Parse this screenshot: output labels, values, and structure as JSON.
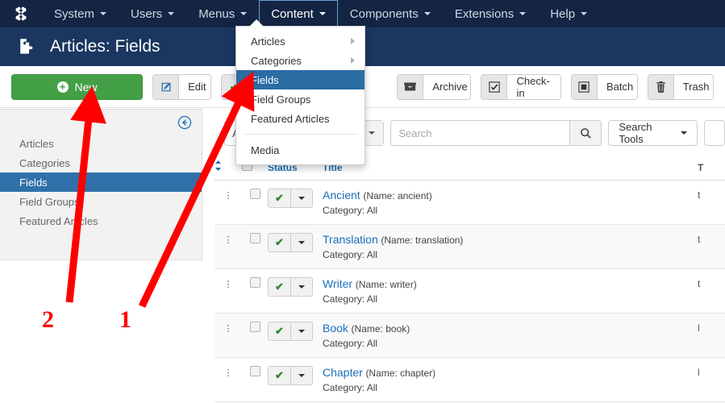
{
  "topbar": {
    "logo_icon": "joomla-logo-icon",
    "items": [
      {
        "label": "System",
        "has_caret": true,
        "active": false
      },
      {
        "label": "Users",
        "has_caret": true,
        "active": false
      },
      {
        "label": "Menus",
        "has_caret": true,
        "active": false
      },
      {
        "label": "Content",
        "has_caret": true,
        "active": true
      },
      {
        "label": "Components",
        "has_caret": true,
        "active": false
      },
      {
        "label": "Extensions",
        "has_caret": true,
        "active": false
      },
      {
        "label": "Help",
        "has_caret": true,
        "active": false
      }
    ]
  },
  "content_menu": {
    "items": [
      {
        "label": "Articles",
        "submenu": true,
        "active": false,
        "separator_after": false
      },
      {
        "label": "Categories",
        "submenu": true,
        "active": false,
        "separator_after": false
      },
      {
        "label": "Fields",
        "submenu": false,
        "active": true,
        "separator_after": false
      },
      {
        "label": "Field Groups",
        "submenu": false,
        "active": false,
        "separator_after": false
      },
      {
        "label": "Featured Articles",
        "submenu": false,
        "active": false,
        "separator_after": true
      },
      {
        "label": "Media",
        "submenu": false,
        "active": false,
        "separator_after": false
      }
    ]
  },
  "page_header": {
    "title": "Articles: Fields",
    "icon": "puzzle-piece-icon"
  },
  "toolbar": {
    "new_label": "New",
    "edit_label": "Edit",
    "publish_label": "",
    "archive_label": "Archive",
    "checkin_label": "Check-in",
    "batch_label": "Batch",
    "trash_label": "Trash",
    "new_icon": "plus-circle-icon",
    "edit_icon": "pencil-square-icon",
    "publish_icon": "check-icon",
    "archive_icon": "archive-box-icon",
    "checkin_icon": "checked-box-icon",
    "batch_icon": "filled-square-icon",
    "trash_icon": "trash-can-icon"
  },
  "sidebar": {
    "collapse_icon": "collapse-left-arrow-icon",
    "items": [
      {
        "label": "Articles",
        "active": false
      },
      {
        "label": "Categories",
        "active": false
      },
      {
        "label": "Fields",
        "active": true
      },
      {
        "label": "Field Groups",
        "active": false
      },
      {
        "label": "Featured Articles",
        "active": false
      }
    ]
  },
  "filterbar": {
    "select_value": "A",
    "select_icon": "chevron-down-icon",
    "search_placeholder": "Search",
    "search_value": "",
    "search_icon": "search-icon",
    "search_tools_label": "Search Tools",
    "search_tools_icon": "caret-down-icon"
  },
  "table": {
    "headers": {
      "ordering": "",
      "checkbox": "",
      "status": "Status",
      "title": "Title",
      "access": "T"
    },
    "sort_icon": "sort-updown-icon",
    "row_menu_icon": "vertical-dots-icon",
    "status_check_icon": "check-icon",
    "status_caret_icon": "caret-down-icon",
    "rows": [
      {
        "title": "Ancient",
        "name_note": "(Name: ancient)",
        "category": "Category: All",
        "status": "published",
        "edge": "t"
      },
      {
        "title": "Translation",
        "name_note": "(Name: translation)",
        "category": "Category: All",
        "status": "published",
        "edge": "t"
      },
      {
        "title": "Writer",
        "name_note": "(Name: writer)",
        "category": "Category: All",
        "status": "published",
        "edge": "t"
      },
      {
        "title": "Book",
        "name_note": "(Name: book)",
        "category": "Category: All",
        "status": "published",
        "edge": "l"
      },
      {
        "title": "Chapter",
        "name_note": "(Name: chapter)",
        "category": "Category: All",
        "status": "published",
        "edge": "l"
      }
    ]
  },
  "annotations": [
    {
      "label": "2",
      "target": "new-button"
    },
    {
      "label": "1",
      "target": "content-menu-fields-item"
    }
  ]
}
